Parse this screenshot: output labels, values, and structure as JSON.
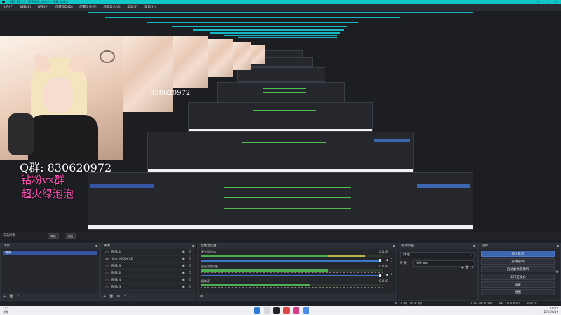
{
  "window": {
    "title": "OBS 29.1.3 - 配置文件: 未命名 - 场景: 未命名"
  },
  "menu": [
    "文件(F)",
    "编辑(E)",
    "视图(V)",
    "停靠窗口(D)",
    "配置文件(P)",
    "场景集合(S)",
    "工具(T)",
    "帮助(H)"
  ],
  "overlay": {
    "qq": "Q群: 830620972",
    "fans": "钻粉vx群",
    "hot": "超火绿泡泡",
    "nested_number": "830620972"
  },
  "scene_toolbar": {
    "label": "未选择源",
    "properties": "属性",
    "filters": "滤镜"
  },
  "scenes": {
    "title": "场景",
    "items": [
      "场景"
    ]
  },
  "sources": {
    "title": "来源",
    "items": [
      "图像 2",
      "文本 (GDI+) 2",
      "图像 3",
      "图像 2",
      "图像 4",
      "图像 5"
    ]
  },
  "mixer": {
    "title": "音频混音器",
    "channels": [
      {
        "name": "麦克风/Aux",
        "db": "0.0 dB",
        "level": 0.9
      },
      {
        "name": "桌面音频设备",
        "db": "0.0 dB",
        "level": 0.7
      },
      {
        "name": "媒体源",
        "db": "0.0 dB",
        "level": 0.6
      }
    ]
  },
  "transitions": {
    "title": "转场动画",
    "selected": "渐变",
    "duration_label": "时长",
    "duration_value": "300 ms"
  },
  "controls": {
    "title": "控件",
    "buttons": [
      "停止推流",
      "开始录制",
      "启动虚拟摄像机",
      "工作室模式",
      "设置",
      "退出"
    ]
  },
  "status": {
    "live": "LIVE: 00:00:00",
    "rec": "REC: 00:00:00",
    "cpu": "CPU: 2.3%, 30.00 fps",
    "kbps": "kb/s: 0"
  },
  "taskbar": {
    "weather_temp": "27°C",
    "weather_desc": "多云",
    "time": "19:22",
    "date": "2023/8/19"
  },
  "colors": {
    "accent": "#17b6c4",
    "title_bar": "#11c6c6",
    "overlay_pink": "#ff4fb3",
    "active_button": "#3c66b0"
  }
}
